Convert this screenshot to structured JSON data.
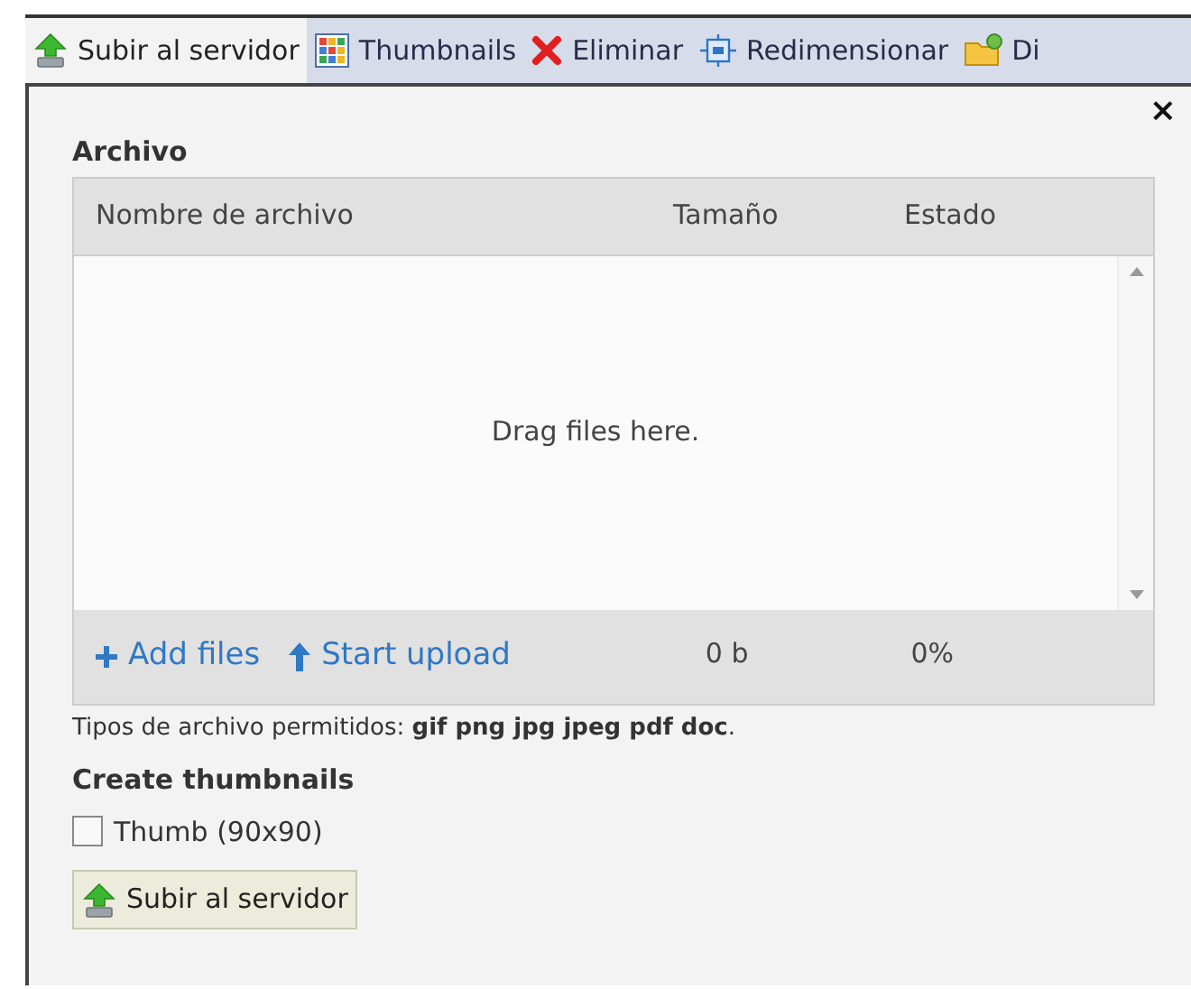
{
  "tabs": [
    {
      "label": "Subir al servidor",
      "kind": "upload",
      "selected": true
    },
    {
      "label": "Thumbnails",
      "kind": "grid",
      "selected": false
    },
    {
      "label": "Eliminar",
      "kind": "delete",
      "selected": false
    },
    {
      "label": "Redimensionar",
      "kind": "resize",
      "selected": false
    },
    {
      "label": "Di",
      "kind": "folder",
      "selected": false
    }
  ],
  "close": "×",
  "section_title": "Archivo",
  "table": {
    "columns": [
      "Nombre de archivo",
      "Tamaño",
      "Estado"
    ],
    "empty_message": "Drag files here.",
    "footer": {
      "add": "Add files",
      "start": "Start upload",
      "size": "0 b",
      "percent": "0%"
    }
  },
  "allowed_types": "Tipos de archivo permitidos: **gif png jpg jpeg pdf doc**.",
  "thumbnails": {
    "title": "Create thumbnails",
    "options": [
      {
        "label": "Thumb (90x90)",
        "checked": false
      }
    ]
  },
  "submit": "Subir al servidor"
}
